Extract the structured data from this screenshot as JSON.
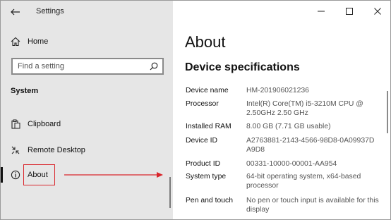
{
  "window": {
    "title": "Settings"
  },
  "nav": {
    "home_label": "Home",
    "search_placeholder": "Find a setting",
    "section_title": "System",
    "items": [
      {
        "label": "Clipboard",
        "icon": "clipboard-icon"
      },
      {
        "label": "Remote Desktop",
        "icon": "remote-desktop-icon"
      },
      {
        "label": "About",
        "icon": "info-icon",
        "selected": true
      }
    ]
  },
  "main": {
    "title": "About",
    "section_title": "Device specifications",
    "specs": [
      {
        "key": "Device name",
        "value": "HM-201906021236"
      },
      {
        "key": "Processor",
        "value": "Intel(R) Core(TM) i5-3210M CPU @ 2.50GHz   2.50 GHz"
      },
      {
        "key": "Installed RAM",
        "value": "8.00 GB (7.71 GB usable)"
      },
      {
        "key": "Device ID",
        "value": "A2763881-2143-4566-98D8-0A09937D A9D8"
      },
      {
        "key": "Product ID",
        "value": "00331-10000-00001-AA954"
      },
      {
        "key": "System type",
        "value": "64-bit operating system, x64-based processor"
      },
      {
        "key": "Pen and touch",
        "value": "No pen or touch input is available for this display"
      }
    ]
  },
  "annotation": {
    "color": "#d9262c"
  }
}
